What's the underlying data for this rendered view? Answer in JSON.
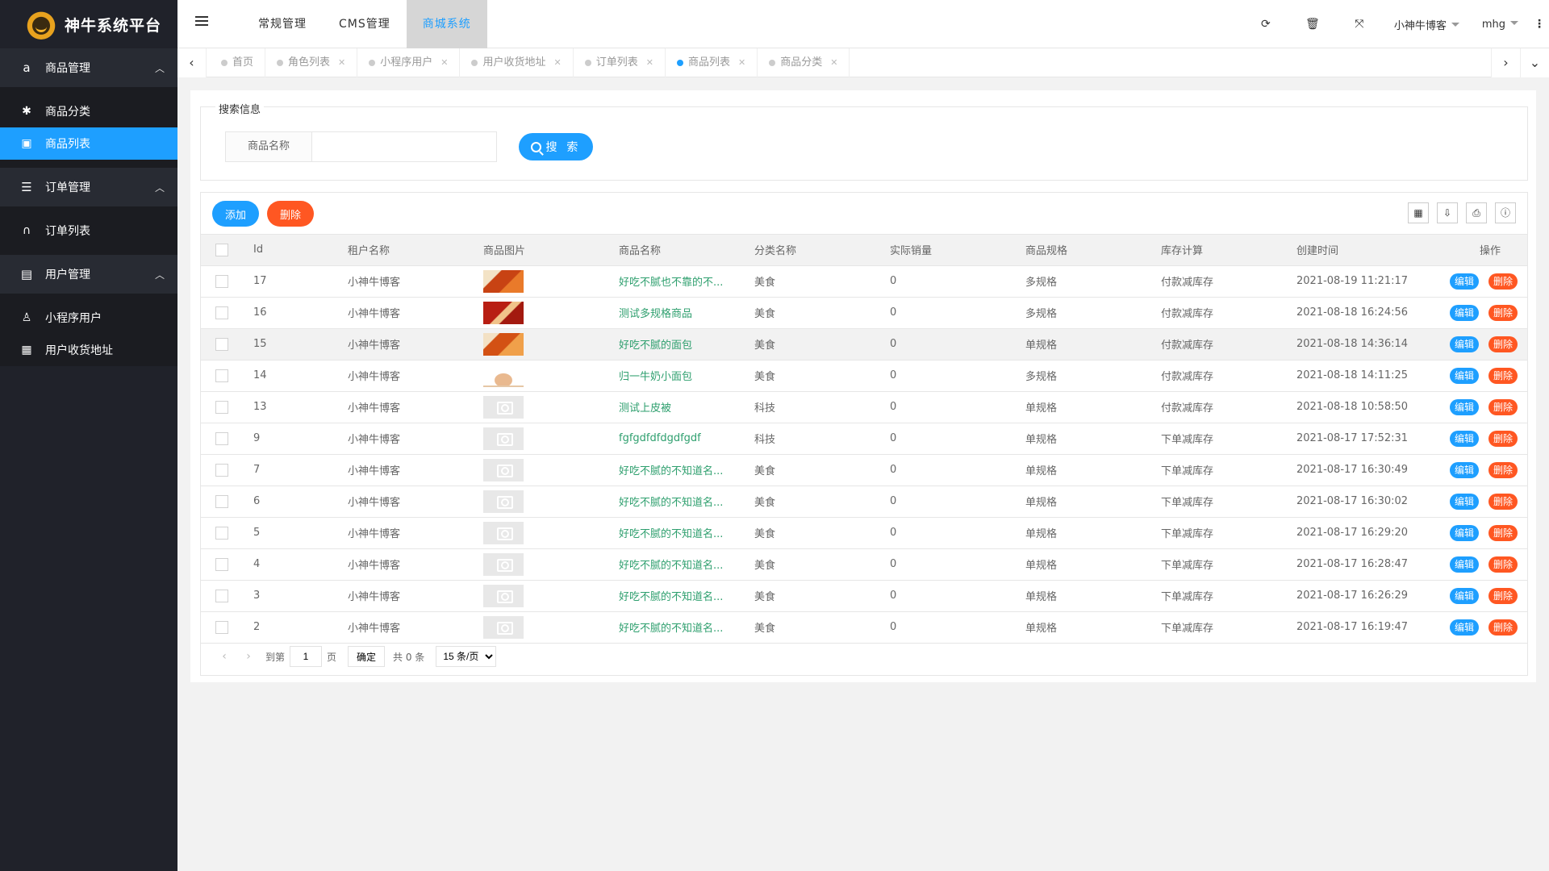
{
  "app": {
    "logo_text": "神牛系统平台"
  },
  "sidebar": {
    "groups": [
      {
        "label": "商品管理",
        "icon": "amazon-icon",
        "items": [
          {
            "label": "商品分类",
            "icon": "bug-icon"
          },
          {
            "label": "商品列表",
            "icon": "image-icon"
          }
        ]
      },
      {
        "label": "订单管理",
        "icon": "list-icon",
        "items": [
          {
            "label": "订单列表",
            "icon": "binoculars-icon"
          }
        ]
      },
      {
        "label": "用户管理",
        "icon": "id-card-icon",
        "items": [
          {
            "label": "小程序用户",
            "icon": "walking-icon"
          },
          {
            "label": "用户收货地址",
            "icon": "briefcase-icon"
          }
        ]
      }
    ]
  },
  "header": {
    "nav": [
      "常规管理",
      "CMS管理",
      "商城系统"
    ],
    "user1": "小神牛博客",
    "user2": "mhg"
  },
  "tabs": [
    {
      "label": "首页",
      "closable": false
    },
    {
      "label": "角色列表",
      "closable": true
    },
    {
      "label": "小程序用户",
      "closable": true
    },
    {
      "label": "用户收货地址",
      "closable": true
    },
    {
      "label": "订单列表",
      "closable": true
    },
    {
      "label": "商品列表",
      "closable": true,
      "active": true
    },
    {
      "label": "商品分类",
      "closable": true
    }
  ],
  "search": {
    "legend": "搜索信息",
    "label": "商品名称",
    "value": "",
    "button": "搜 索"
  },
  "toolbar": {
    "add": "添加",
    "delete": "删除"
  },
  "table": {
    "headers": [
      "Id",
      "租户名称",
      "商品图片",
      "商品名称",
      "分类名称",
      "实际销量",
      "商品规格",
      "库存计算",
      "创建时间",
      "操作"
    ],
    "edit_label": "编辑",
    "delete_label": "删除",
    "rows": [
      {
        "id": "17",
        "tenant": "小神牛博客",
        "img": "bread1",
        "name": "好吃不腻也不靠的不...",
        "cat": "美食",
        "sales": "0",
        "spec": "多规格",
        "stock": "付款减库存",
        "time": "2021-08-19 11:21:17"
      },
      {
        "id": "16",
        "tenant": "小神牛博客",
        "img": "bread2",
        "name": "测试多规格商品",
        "cat": "美食",
        "sales": "0",
        "spec": "多规格",
        "stock": "付款减库存",
        "time": "2021-08-18 16:24:56"
      },
      {
        "id": "15",
        "tenant": "小神牛博客",
        "img": "bread3",
        "name": "好吃不腻的面包",
        "cat": "美食",
        "sales": "0",
        "spec": "单规格",
        "stock": "付款减库存",
        "time": "2021-08-18 14:36:14"
      },
      {
        "id": "14",
        "tenant": "小神牛博客",
        "img": "bread4",
        "name": "归一牛奶小面包",
        "cat": "美食",
        "sales": "0",
        "spec": "多规格",
        "stock": "付款减库存",
        "time": "2021-08-18 14:11:25"
      },
      {
        "id": "13",
        "tenant": "小神牛博客",
        "img": "placeholder",
        "name": "测试上皮被",
        "cat": "科技",
        "sales": "0",
        "spec": "单规格",
        "stock": "付款减库存",
        "time": "2021-08-18 10:58:50"
      },
      {
        "id": "9",
        "tenant": "小神牛博客",
        "img": "placeholder",
        "name": "fgfgdfdfdgdfgdf",
        "cat": "科技",
        "sales": "0",
        "spec": "单规格",
        "stock": "下单减库存",
        "time": "2021-08-17 17:52:31"
      },
      {
        "id": "7",
        "tenant": "小神牛博客",
        "img": "placeholder",
        "name": "好吃不腻的不知道名...",
        "cat": "美食",
        "sales": "0",
        "spec": "单规格",
        "stock": "下单减库存",
        "time": "2021-08-17 16:30:49"
      },
      {
        "id": "6",
        "tenant": "小神牛博客",
        "img": "placeholder",
        "name": "好吃不腻的不知道名...",
        "cat": "美食",
        "sales": "0",
        "spec": "单规格",
        "stock": "下单减库存",
        "time": "2021-08-17 16:30:02"
      },
      {
        "id": "5",
        "tenant": "小神牛博客",
        "img": "placeholder",
        "name": "好吃不腻的不知道名...",
        "cat": "美食",
        "sales": "0",
        "spec": "单规格",
        "stock": "下单减库存",
        "time": "2021-08-17 16:29:20"
      },
      {
        "id": "4",
        "tenant": "小神牛博客",
        "img": "placeholder",
        "name": "好吃不腻的不知道名...",
        "cat": "美食",
        "sales": "0",
        "spec": "单规格",
        "stock": "下单减库存",
        "time": "2021-08-17 16:28:47"
      },
      {
        "id": "3",
        "tenant": "小神牛博客",
        "img": "placeholder",
        "name": "好吃不腻的不知道名...",
        "cat": "美食",
        "sales": "0",
        "spec": "单规格",
        "stock": "下单减库存",
        "time": "2021-08-17 16:26:29"
      },
      {
        "id": "2",
        "tenant": "小神牛博客",
        "img": "placeholder",
        "name": "好吃不腻的不知道名...",
        "cat": "美食",
        "sales": "0",
        "spec": "单规格",
        "stock": "下单减库存",
        "time": "2021-08-17 16:19:47"
      }
    ]
  },
  "pager": {
    "goto_label": "到第",
    "page_value": "1",
    "page_unit": "页",
    "confirm": "确定",
    "total": "共 0 条",
    "page_size": "15 条/页"
  }
}
